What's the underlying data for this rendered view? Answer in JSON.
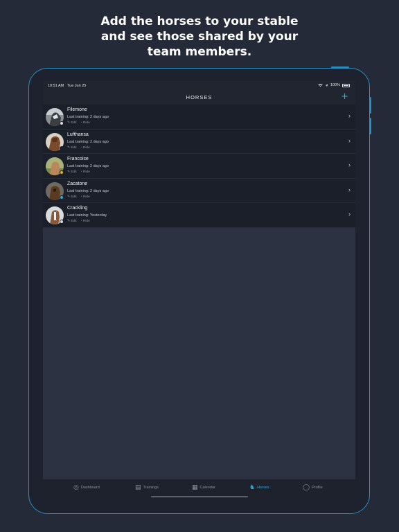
{
  "headline": {
    "line1": "Add the horses to your stable",
    "line2": "and see those shared by your",
    "line3": "team members."
  },
  "statusbar": {
    "time": "10:51 AM",
    "date": "Tue Jun 25",
    "battery": "100%"
  },
  "navbar": {
    "title": "HORSES",
    "add_icon": "+"
  },
  "horses": [
    {
      "name": "Filemone",
      "last_training": "Last training: 2 days ago",
      "edit": "Edit",
      "ride": "Ride",
      "status_color": "#d9dde4"
    },
    {
      "name": "Lufthansa",
      "last_training": "Last training: 2 days ago",
      "edit": "Edit",
      "ride": "Ride",
      "status_color": "#1a1f29"
    },
    {
      "name": "Francoise",
      "last_training": "Last training: 2 days ago",
      "edit": "Edit",
      "ride": "Ride",
      "status_color": "#e8b020"
    },
    {
      "name": "Zacatone",
      "last_training": "Last training: 2 days ago",
      "edit": "Edit",
      "ride": "Ride",
      "status_color": "#30a8dc"
    },
    {
      "name": "Crackling",
      "last_training": "Last training: Yesterday",
      "edit": "Edit",
      "ride": "Ride",
      "status_color": "#d9dde4"
    }
  ],
  "tabbar": {
    "dashboard": "Dashboard",
    "trainings": "Trainings",
    "calendar": "Calendar",
    "horses": "Horses",
    "profile": "Profile"
  },
  "colors": {
    "accent": "#30a8dc",
    "frame": "#2b8fc4",
    "background": "#242a37"
  }
}
